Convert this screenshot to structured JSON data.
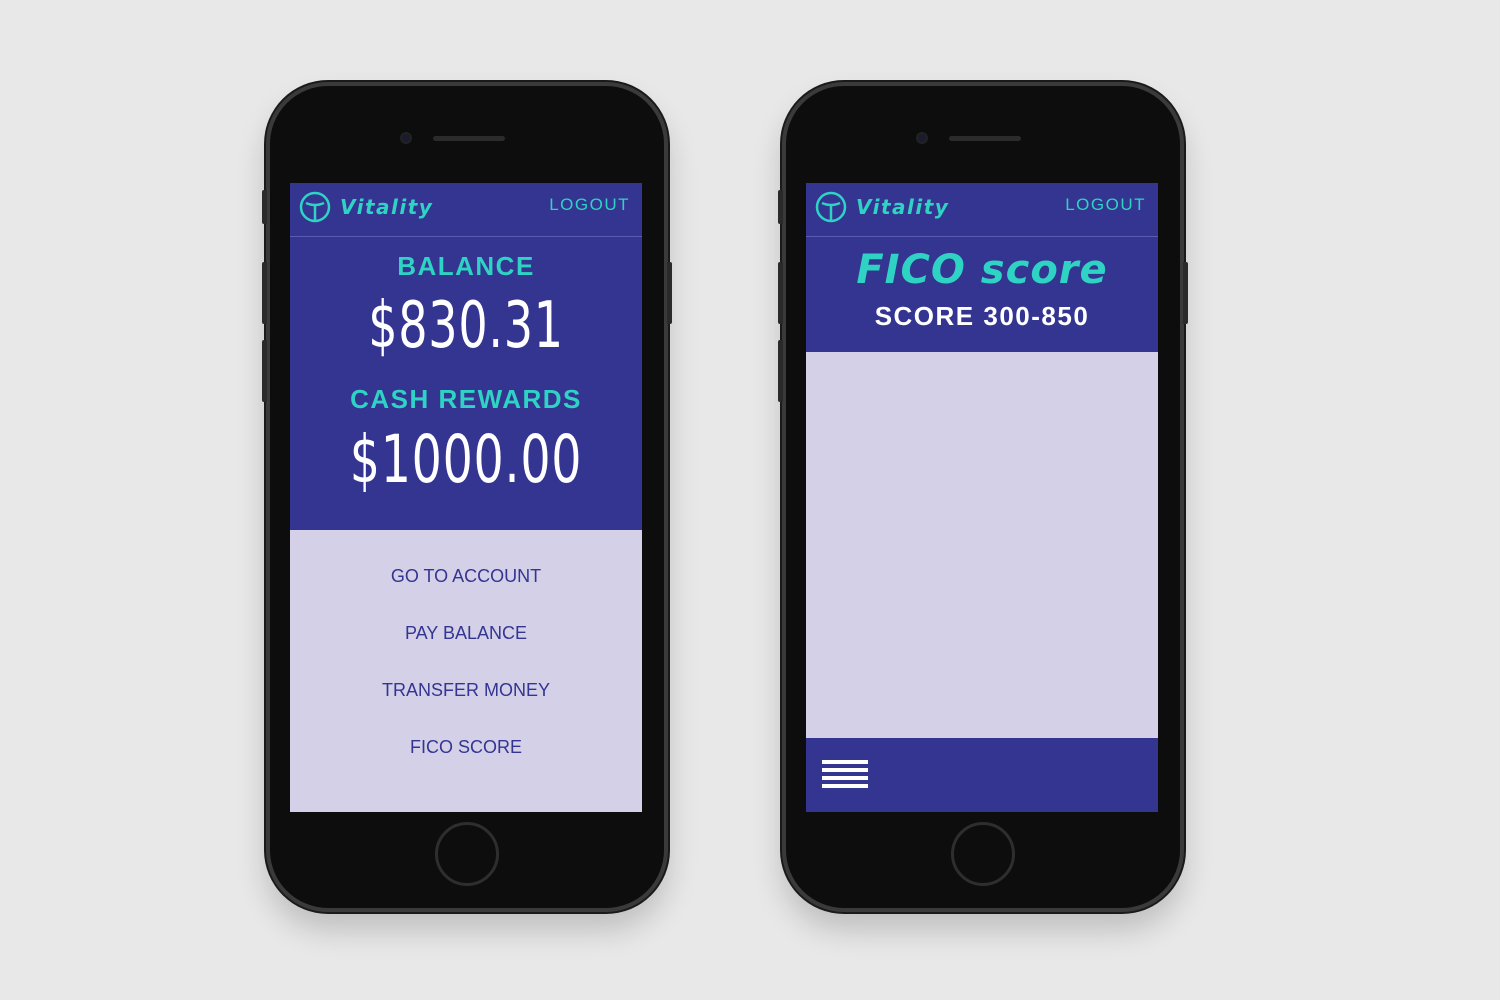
{
  "brand": {
    "name": "Vitality",
    "accent_color": "#2fd3c4",
    "primary_color": "#343591",
    "surface_color": "#d3d0e8"
  },
  "dashboard_screen": {
    "header": {
      "logout_label": "LOGOUT"
    },
    "balance_label": "BALANCE",
    "balance_value": "$830.31",
    "rewards_label": "CASH REWARDS",
    "rewards_value": "$1000.00",
    "menu": [
      {
        "label": "GO TO ACCOUNT"
      },
      {
        "label": "PAY BALANCE"
      },
      {
        "label": "TRANSFER MONEY"
      },
      {
        "label": "FICO SCORE"
      }
    ]
  },
  "fico_screen": {
    "header": {
      "logout_label": "LOGOUT"
    },
    "title": "FICO score",
    "range_label": "SCORE 300-850",
    "menu_icon": "hamburger-menu-icon"
  }
}
